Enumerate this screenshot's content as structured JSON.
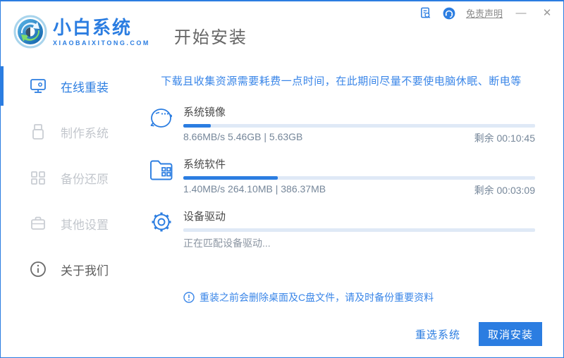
{
  "window": {
    "brand_name": "小白系统",
    "brand_domain": "XIAOBAIXITONG.COM",
    "page_title": "开始安装",
    "titlebar": {
      "disclaimer_link": "免责声明",
      "minimize_glyph": "—",
      "close_glyph": "✕"
    }
  },
  "sidebar": {
    "items": [
      {
        "label": "在线重装",
        "icon": "monitor-icon",
        "active": true
      },
      {
        "label": "制作系统",
        "icon": "usb-icon",
        "active": false
      },
      {
        "label": "备份还原",
        "icon": "backup-blocks-icon",
        "active": false
      },
      {
        "label": "其他设置",
        "icon": "briefcase-icon",
        "active": false
      },
      {
        "label": "关于我们",
        "icon": "info-icon",
        "active": false
      }
    ]
  },
  "main": {
    "warning": "下载且收集资源需要耗费一点时间，在此期间尽量不要使电脑休眠、断电等",
    "tasks": [
      {
        "name": "系统镜像",
        "progress_percent": 7.8,
        "stats": "8.66MB/s 5.46GB | 5.63GB",
        "remaining": "剩余 00:10:45"
      },
      {
        "name": "系统软件",
        "progress_percent": 26.8,
        "stats": "1.40MB/s 264.10MB | 386.37MB",
        "remaining": "剩余 00:03:09"
      },
      {
        "name": "设备驱动",
        "progress_percent": 0,
        "status": "正在匹配设备驱动..."
      }
    ],
    "notice": "重装之前会删除桌面及C盘文件，请及时备份重要资料"
  },
  "footer": {
    "reselect_label": "重选系统",
    "cancel_label": "取消安装"
  },
  "colors": {
    "primary": "#2b7de1",
    "text_blue": "#3a86e8",
    "track": "#dfe9f6",
    "inactive_gray": "#c3c7cd"
  }
}
